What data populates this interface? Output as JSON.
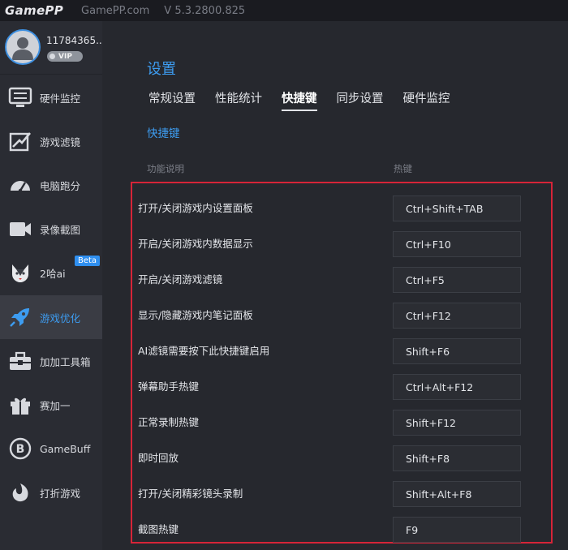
{
  "titlebar": {
    "logo_text": "GamePP",
    "site": "GamePP.com",
    "version": "V 5.3.2800.825"
  },
  "user": {
    "name": "11784365...",
    "badge": "VIP"
  },
  "sidebar": {
    "items": [
      {
        "label": "硬件监控",
        "icon": "hardware-monitor-icon"
      },
      {
        "label": "游戏滤镜",
        "icon": "game-filter-icon"
      },
      {
        "label": "电脑跑分",
        "icon": "speedometer-icon"
      },
      {
        "label": "录像截图",
        "icon": "video-camera-icon"
      },
      {
        "label": "2哈ai",
        "icon": "husky-icon",
        "badge": "Beta"
      },
      {
        "label": "游戏优化",
        "icon": "rocket-icon",
        "active": true
      },
      {
        "label": "加加工具箱",
        "icon": "toolbox-icon"
      },
      {
        "label": "赛加一",
        "icon": "gift-icon"
      },
      {
        "label": "GameBuff",
        "icon": "gamebuff-icon"
      },
      {
        "label": "打折游戏",
        "icon": "discount-game-icon"
      }
    ]
  },
  "main": {
    "title": "设置",
    "tabs": [
      {
        "label": "常规设置"
      },
      {
        "label": "性能统计"
      },
      {
        "label": "快捷键",
        "active": true
      },
      {
        "label": "同步设置"
      },
      {
        "label": "硬件监控"
      }
    ],
    "section_title": "快捷键",
    "columns": {
      "description": "功能说明",
      "hotkey": "热键"
    },
    "rows": [
      {
        "desc": "打开/关闭游戏内设置面板",
        "key": "Ctrl+Shift+TAB"
      },
      {
        "desc": "开启/关闭游戏内数据显示",
        "key": "Ctrl+F10"
      },
      {
        "desc": "开启/关闭游戏滤镜",
        "key": "Ctrl+F5"
      },
      {
        "desc": "显示/隐藏游戏内笔记面板",
        "key": "Ctrl+F12"
      },
      {
        "desc": "AI滤镜需要按下此快捷键启用",
        "key": "Shift+F6"
      },
      {
        "desc": "弹幕助手热键",
        "key": "Ctrl+Alt+F12"
      },
      {
        "desc": "正常录制热键",
        "key": "Shift+F12"
      },
      {
        "desc": "即时回放",
        "key": "Shift+F8"
      },
      {
        "desc": "打开/关闭精彩镜头录制",
        "key": "Shift+Alt+F8"
      },
      {
        "desc": "截图热键",
        "key": "F9"
      }
    ]
  },
  "colors": {
    "accent": "#3d9cf0",
    "highlight_border": "#d62438",
    "background": "#26282e",
    "sidebar": "#2a2c33"
  }
}
